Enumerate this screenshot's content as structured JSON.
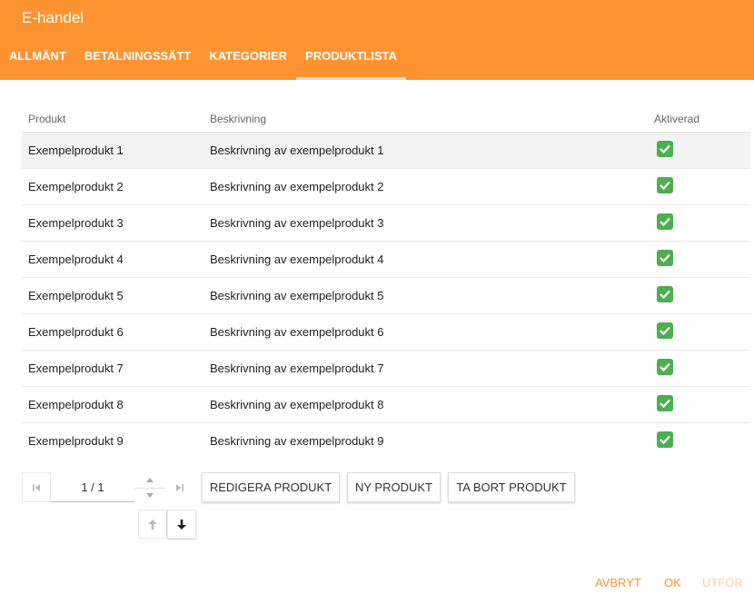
{
  "app": {
    "title": "E-handel"
  },
  "tabs": [
    {
      "label": "ALLMÄNT"
    },
    {
      "label": "BETALNINGSSÄTT"
    },
    {
      "label": "KATEGORIER"
    },
    {
      "label": "PRODUKTLISTA",
      "active": true
    }
  ],
  "grid": {
    "columns": [
      "Produkt",
      "Beskrivning",
      "Aktiverad"
    ],
    "rows": [
      {
        "product": "Exempelprodukt 1",
        "description": "Beskrivning av exempelprodukt 1",
        "active": true
      },
      {
        "product": "Exempelprodukt 2",
        "description": "Beskrivning av exempelprodukt 2",
        "active": true
      },
      {
        "product": "Exempelprodukt 3",
        "description": "Beskrivning av exempelprodukt 3",
        "active": true
      },
      {
        "product": "Exempelprodukt 4",
        "description": "Beskrivning av exempelprodukt 4",
        "active": true
      },
      {
        "product": "Exempelprodukt 5",
        "description": "Beskrivning av exempelprodukt 5",
        "active": true
      },
      {
        "product": "Exempelprodukt 6",
        "description": "Beskrivning av exempelprodukt 6",
        "active": true
      },
      {
        "product": "Exempelprodukt 7",
        "description": "Beskrivning av exempelprodukt 7",
        "active": true
      },
      {
        "product": "Exempelprodukt 8",
        "description": "Beskrivning av exempelprodukt 8",
        "active": true
      },
      {
        "product": "Exempelprodukt 9",
        "description": "Beskrivning av exempelprodukt 9",
        "active": true
      }
    ],
    "selected_row": 1
  },
  "pager": {
    "page": "1 / 1"
  },
  "buttons": {
    "edit": "REDIGERA PRODUKT",
    "new": "NY PRODUKT",
    "delete": "TA BORT PRODUKT"
  },
  "footer": {
    "cancel": "AVBRYT",
    "ok": "OK",
    "execute": "UTFÖR"
  },
  "colors": {
    "accent": "#fd9331",
    "check": "#4caf50"
  },
  "icons": {
    "first_page": "first-page-icon",
    "last_page": "last-page-icon",
    "move_up": "arrow-up-icon",
    "move_down": "arrow-down-icon",
    "check": "check-icon"
  }
}
